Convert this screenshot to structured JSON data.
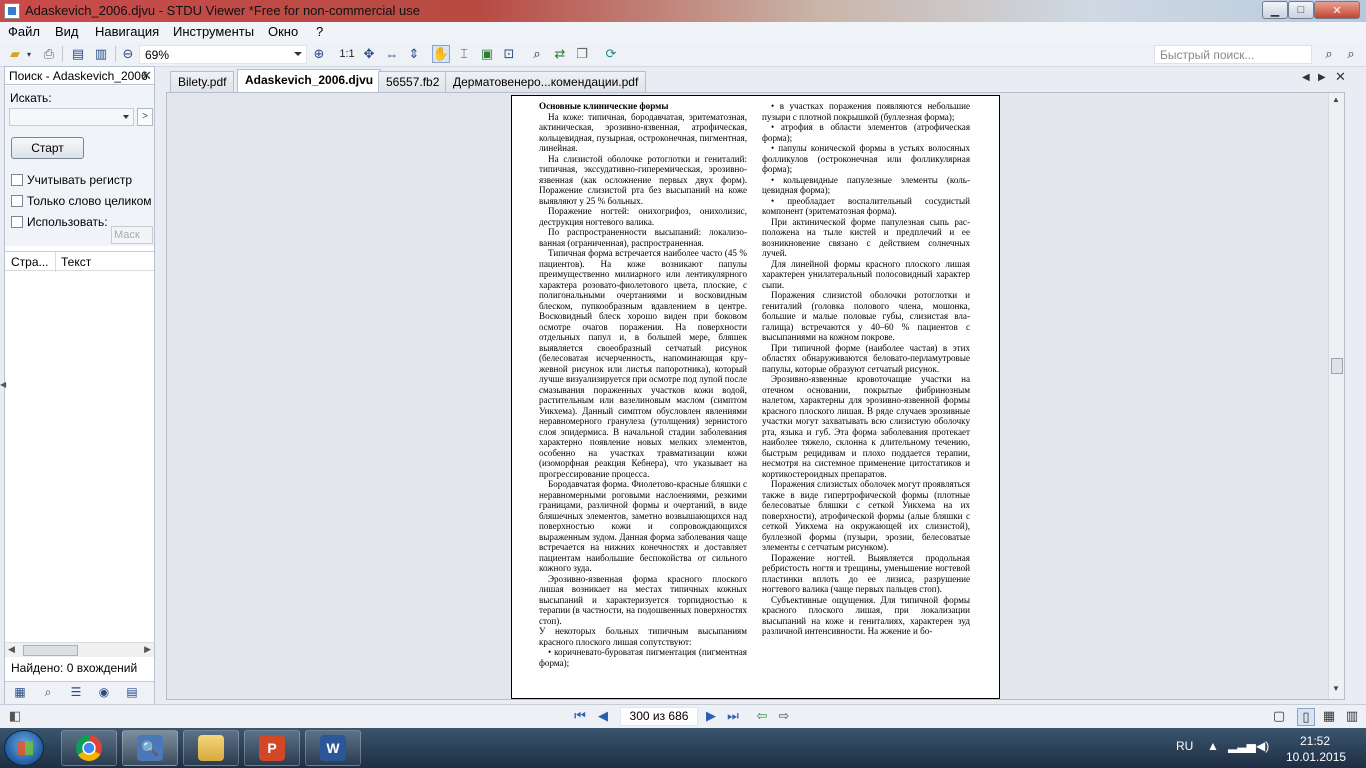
{
  "window": {
    "title": "Adaskevich_2006.djvu - STDU Viewer *Free for non-commercial use",
    "min_icon": "minimize-icon",
    "max_icon": "maximize-icon",
    "close_icon": "close-icon"
  },
  "menu": {
    "file": "Файл",
    "view": "Вид",
    "navigation": "Навигация",
    "tools": "Инструменты",
    "window": "Окно",
    "help": "?"
  },
  "toolbar": {
    "zoom_value": "69%",
    "actual_size": "1:1",
    "quick_search_placeholder": "Быстрый поиск..."
  },
  "left_panel": {
    "tab_title": "Поиск - Adaskevich_2006",
    "search_label": "Искать:",
    "search_value": "",
    "start_button": "Старт",
    "match_case": "Учитывать регистр",
    "whole_word": "Только слово целиком",
    "use_label": "Использовать:",
    "use_value": "Маск",
    "col_page": "Стра...",
    "col_text": "Текст",
    "found": "Найдено: 0 вхождений"
  },
  "tabs": [
    {
      "label": "Bilety.pdf",
      "active": false
    },
    {
      "label": "Adaskevich_2006.djvu",
      "active": true
    },
    {
      "label": "56557.fb2",
      "active": false
    },
    {
      "label": "Дерматовенеро...комендации.pdf",
      "active": false
    }
  ],
  "document": {
    "left_column": [
      {
        "kind": "h",
        "text": "Основные клинические формы"
      },
      {
        "kind": "p",
        "text": "На коже: типичная, бородавчатая, эритематоз­ная, актиническая, эрозивно-язвенная, атрофи­ческая, кольцевидная, пузырная, остроконечная, пигментная, линейная."
      },
      {
        "kind": "p",
        "text": "На слизистой оболочке ротоглотки и гениталий: типичная, экссудативно-гиперемическая, эрозивно-язвенная (как осложнение первых двух форм). Поражение слизистой рта без высыпаний на коже выявляют у 25 % больных."
      },
      {
        "kind": "p",
        "text": "Поражение ногтей: онихогрифоз, онихолизис, деструкция ногтевого валика."
      },
      {
        "kind": "p",
        "text": "По распространенности высыпаний: локализо­ванная (ограниченная), распространенная."
      },
      {
        "kind": "p",
        "text": "Типичная форма встречается наиболее часто (45 % пациентов). На коже возникают папулы преимущественно милиарного или лентикуляр­ного характера розовато-фиолетового цвета, плос­кие, с полигональными очертаниями и воско­видным блеском, пупкообразным вдавлением в центре. Восковидный блеск хорошо виден при боковом осмотре очагов поражения. На поверх­ности отдельных папул и, в большей мере, бля­шек выявляется своеобразный сетчатый рисунок (белесоватая исчерченность, напоминающая кру­жевной рисунок или листья папоротника), ко­торый лучше визуализируется при осмотре под лупой после смазывания пораженных участков кожи водой, растительным или вазелиновым маслом (симптом Уикхема). Данный симптом обусловлен явлениями неравномерного гранулеза (утолщения) зернистого слоя эпидермиса. В на­чальной стадии заболевания характерно появле­ние новых мелких элементов, особенно на уча­стках травматизации кожи (изоморфная реакция Кебнера), что указывает на прогрессирование процесса."
      },
      {
        "kind": "p",
        "text": "Бородавчатая форма. Фиолетово-красные бляшки с неравномерными роговыми наслоени­ями, резкими границами, различной формы и очертаний, в виде бляшечных элементов, заметно возвышающихся над поверхностью кожи и со­провождающихся выраженным зудом. Данная форма заболевания чаще встречается на нижних конечностях и доставляет пациентам наибольшие беспокойства от сильного кожного зуда."
      },
      {
        "kind": "p",
        "text": "Эрозивно-язвенная форма красного плоского лишая возникает на местах типичных кожных высыпаний и характеризуется торпидностью к терапии (в частности, на подошвенных поверх­ностях стоп)."
      },
      {
        "kind": "noind",
        "text": "У некоторых больных типичным высыпаниям красного плоского лишая сопутствуют:"
      },
      {
        "kind": "p",
        "text": "• коричневато-буроватая пигментация (пиг­ментная форма);"
      }
    ],
    "right_column": [
      {
        "kind": "p",
        "text": "• в участках поражения появляются неболь­шие пузыри с плотной покрышкой (буллезная форма);"
      },
      {
        "kind": "p",
        "text": "• атрофия в области элементов (атрофическая форма);"
      },
      {
        "kind": "p",
        "text": "• папулы конической формы в устьях воло­сяных фолликулов (остроконечная или фоллику­лярная форма);"
      },
      {
        "kind": "p",
        "text": "• кольцевидные папулезные элементы (коль­цевидная форма);"
      },
      {
        "kind": "p",
        "text": "• преобладает воспалительный сосудистый компонент (эритематозная форма)."
      },
      {
        "kind": "p",
        "text": "При актинической форме папулезная сыпь рас­положена на тыле кистей и предплечий и ее возникновение связано с действием солнечных лучей."
      },
      {
        "kind": "p",
        "text": "Для линейной формы красного плоского лишая характерен унилатеральный полосовидный ха­рактер сыпи."
      },
      {
        "kind": "p",
        "text": "Поражения слизистой оболочки ротоглотки и гениталий (головка полового члена, мошонка, большие и малые половые губы, слизистая вла­галища) встречаются у 40–60 % пациентов с высыпаниями на кожном покрове."
      },
      {
        "kind": "p",
        "text": "При типичной форме (наиболее частая) в этих областях обнаруживаются беловато-перламутро­вые папулы, которые образуют сетчатый рису­нок."
      },
      {
        "kind": "p",
        "text": "Эрозивно-язвенные кровоточащие участки на отечном основании, покрытые фибринозным налетом, характерны для эрозивно-язвенной фор­мы красного плоского лишая. В ряде случаев эро­зивные участки могут захватывать всю слизис­тую оболочку рта, языка и губ. Эта форма заболевания протекает наиболее тяжело, склон­на к длительному течению, быстрым рецидивам и плохо поддается терапии, несмотря на систем­ное применение цитостатиков и кортикостеро­идных препаратов."
      },
      {
        "kind": "p",
        "text": "Поражения слизистых оболочек могут проявляться также в виде гипертрофической формы (плотные белесоватые бляшки с сеткой Уикхе­ма на их поверхности), атрофической формы (алые бляшки с сеткой Уикхема на окружающей их слизистой), буллезной формы (пузыри, эрозии, белесоватые элементы с сетчатым рисунком)."
      },
      {
        "kind": "p",
        "text": "Поражение ногтей. Выявляется продольная ребристость ногтя и трещины, уменьшение ног­тевой пластинки вплоть до ее лизиса, разруше­ние ногтевого валика (чаще первых пальцев стоп)."
      },
      {
        "kind": "p",
        "text": "Субъективные ощущения. Для типичной фор­мы красного плоского лишая, при локализации высыпаний на коже и гениталиях, характерен зуд различной интенсивности. На жжение и бо-"
      }
    ]
  },
  "statusbar": {
    "page_indicator": "300 из 686"
  },
  "taskbar": {
    "language": "RU",
    "time": "21:52",
    "date": "10.01.2015",
    "apps": [
      {
        "name": "chrome",
        "letter": "",
        "color": "#4caf50"
      },
      {
        "name": "stdu-viewer",
        "letter": "🔍",
        "color": "#4a78b8"
      },
      {
        "name": "file-explorer",
        "letter": "",
        "color": "#e8c25a"
      },
      {
        "name": "powerpoint",
        "letter": "P",
        "color": "#d24726"
      },
      {
        "name": "word",
        "letter": "W",
        "color": "#2b579a"
      }
    ]
  }
}
